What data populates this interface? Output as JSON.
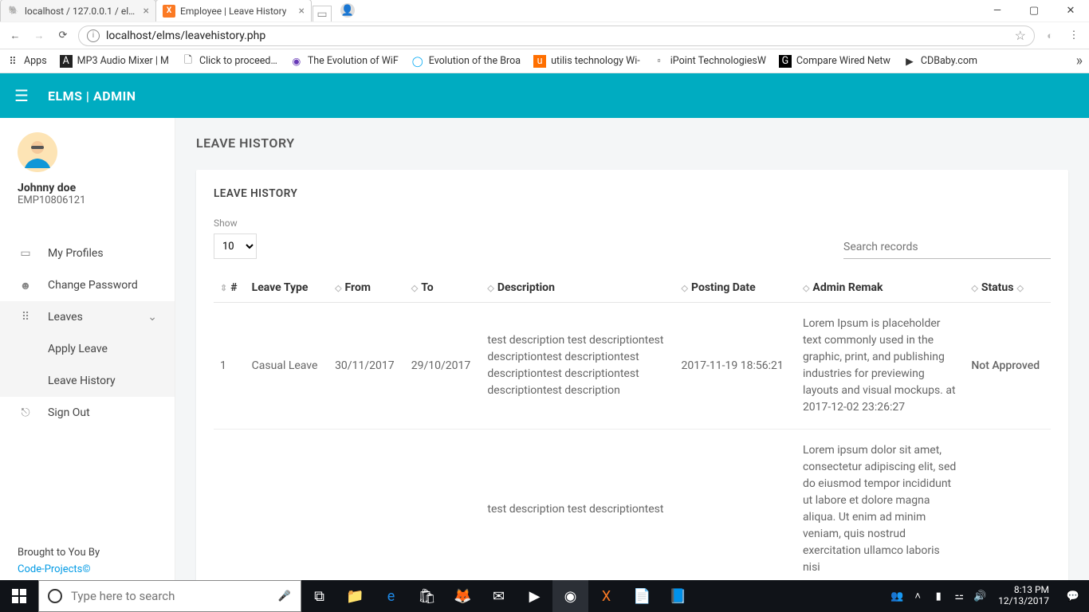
{
  "browser": {
    "tabs": [
      {
        "title": "localhost / 127.0.0.1 / el…",
        "active": false
      },
      {
        "title": "Employee | Leave History",
        "active": true
      }
    ],
    "url": "localhost/elms/leavehistory.php",
    "bookmarks": [
      "Apps",
      "MP3 Audio Mixer | M",
      "Click to proceed…",
      "The Evolution of WiF",
      "Evolution of the Broa",
      "utilis technology Wi-",
      "iPoint TechnologiesW",
      "Compare Wired Netw",
      "CDBaby.com"
    ]
  },
  "header": {
    "brand": "ELMS | ADMIN"
  },
  "sidebar": {
    "user_name": "Johnny doe",
    "user_id": "EMP10806121",
    "items": {
      "profiles": "My Profiles",
      "change_pw": "Change Password",
      "leaves": "Leaves",
      "apply_leave": "Apply Leave",
      "leave_history": "Leave History",
      "sign_out": "Sign Out"
    },
    "footer": {
      "line1": "Brought to You By",
      "link": "Code-Projects©"
    }
  },
  "page": {
    "title": "LEAVE HISTORY",
    "card_title": "LEAVE HISTORY",
    "show_label": "Show",
    "show_value": "10",
    "search_placeholder": "Search records",
    "columns": [
      "#",
      "Leave Type",
      "From",
      "To",
      "Description",
      "Posting Date",
      "Admin Remak",
      "Status"
    ],
    "rows": [
      {
        "n": "1",
        "type": "Casual Leave",
        "from": "30/11/2017",
        "to": "29/10/2017",
        "desc": "test description test descriptiontest descriptiontest descriptiontest descriptiontest descriptiontest descriptiontest description",
        "posting": "2017-11-19 18:56:21",
        "remark": "Lorem Ipsum is placeholder text commonly used in the graphic, print, and publishing industries for previewing layouts and visual mockups. at 2017-12-02 23:26:27",
        "status": "Not Approved"
      },
      {
        "n": "",
        "type": "",
        "from": "",
        "to": "",
        "desc": "test description test descriptiontest",
        "posting": "",
        "remark": "Lorem ipsum dolor sit amet, consectetur adipiscing elit, sed do eiusmod tempor incididunt ut labore et dolore magna aliqua. Ut enim ad minim veniam, quis nostrud exercitation ullamco laboris nisi",
        "status": ""
      }
    ]
  },
  "taskbar": {
    "search_placeholder": "Type here to search",
    "time": "8:13 PM",
    "date": "12/13/2017"
  }
}
